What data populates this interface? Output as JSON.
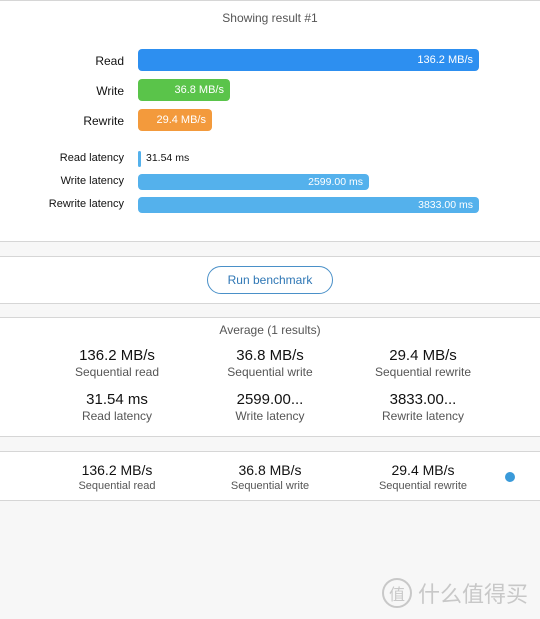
{
  "header": {
    "showing": "Showing result #1"
  },
  "colors": {
    "read": "#2d8ff0",
    "write": "#5ac44a",
    "rewrite": "#f39a3c",
    "latency": "#54b1ec",
    "dot": "#3a9ad9"
  },
  "metrics": [
    {
      "label": "Read",
      "value": "136.2 MB/s",
      "fraction": 1.0
    },
    {
      "label": "Write",
      "value": "36.8 MB/s",
      "fraction": 0.27
    },
    {
      "label": "Rewrite",
      "value": "29.4 MB/s",
      "fraction": 0.216
    }
  ],
  "latencies": [
    {
      "label": "Read latency",
      "value": "31.54 ms",
      "fraction": 0.008
    },
    {
      "label": "Write latency",
      "value": "2599.00 ms",
      "fraction": 0.678
    },
    {
      "label": "Rewrite latency",
      "value": "3833.00 ms",
      "fraction": 1.0
    }
  ],
  "run_button": "Run benchmark",
  "average": {
    "title": "Average (1 results)",
    "stats": [
      {
        "value": "136.2 MB/s",
        "caption": "Sequential read"
      },
      {
        "value": "36.8 MB/s",
        "caption": "Sequential write"
      },
      {
        "value": "29.4 MB/s",
        "caption": "Sequential rewrite"
      },
      {
        "value": "31.54 ms",
        "caption": "Read latency"
      },
      {
        "value": "2599.00...",
        "caption": "Write latency"
      },
      {
        "value": "3833.00...",
        "caption": "Rewrite latency"
      }
    ]
  },
  "result_row": {
    "stats": [
      {
        "value": "136.2 MB/s",
        "caption": "Sequential read"
      },
      {
        "value": "36.8 MB/s",
        "caption": "Sequential write"
      },
      {
        "value": "29.4 MB/s",
        "caption": "Sequential rewrite"
      }
    ]
  },
  "watermark": {
    "icon": "值",
    "text": "什么值得买"
  }
}
